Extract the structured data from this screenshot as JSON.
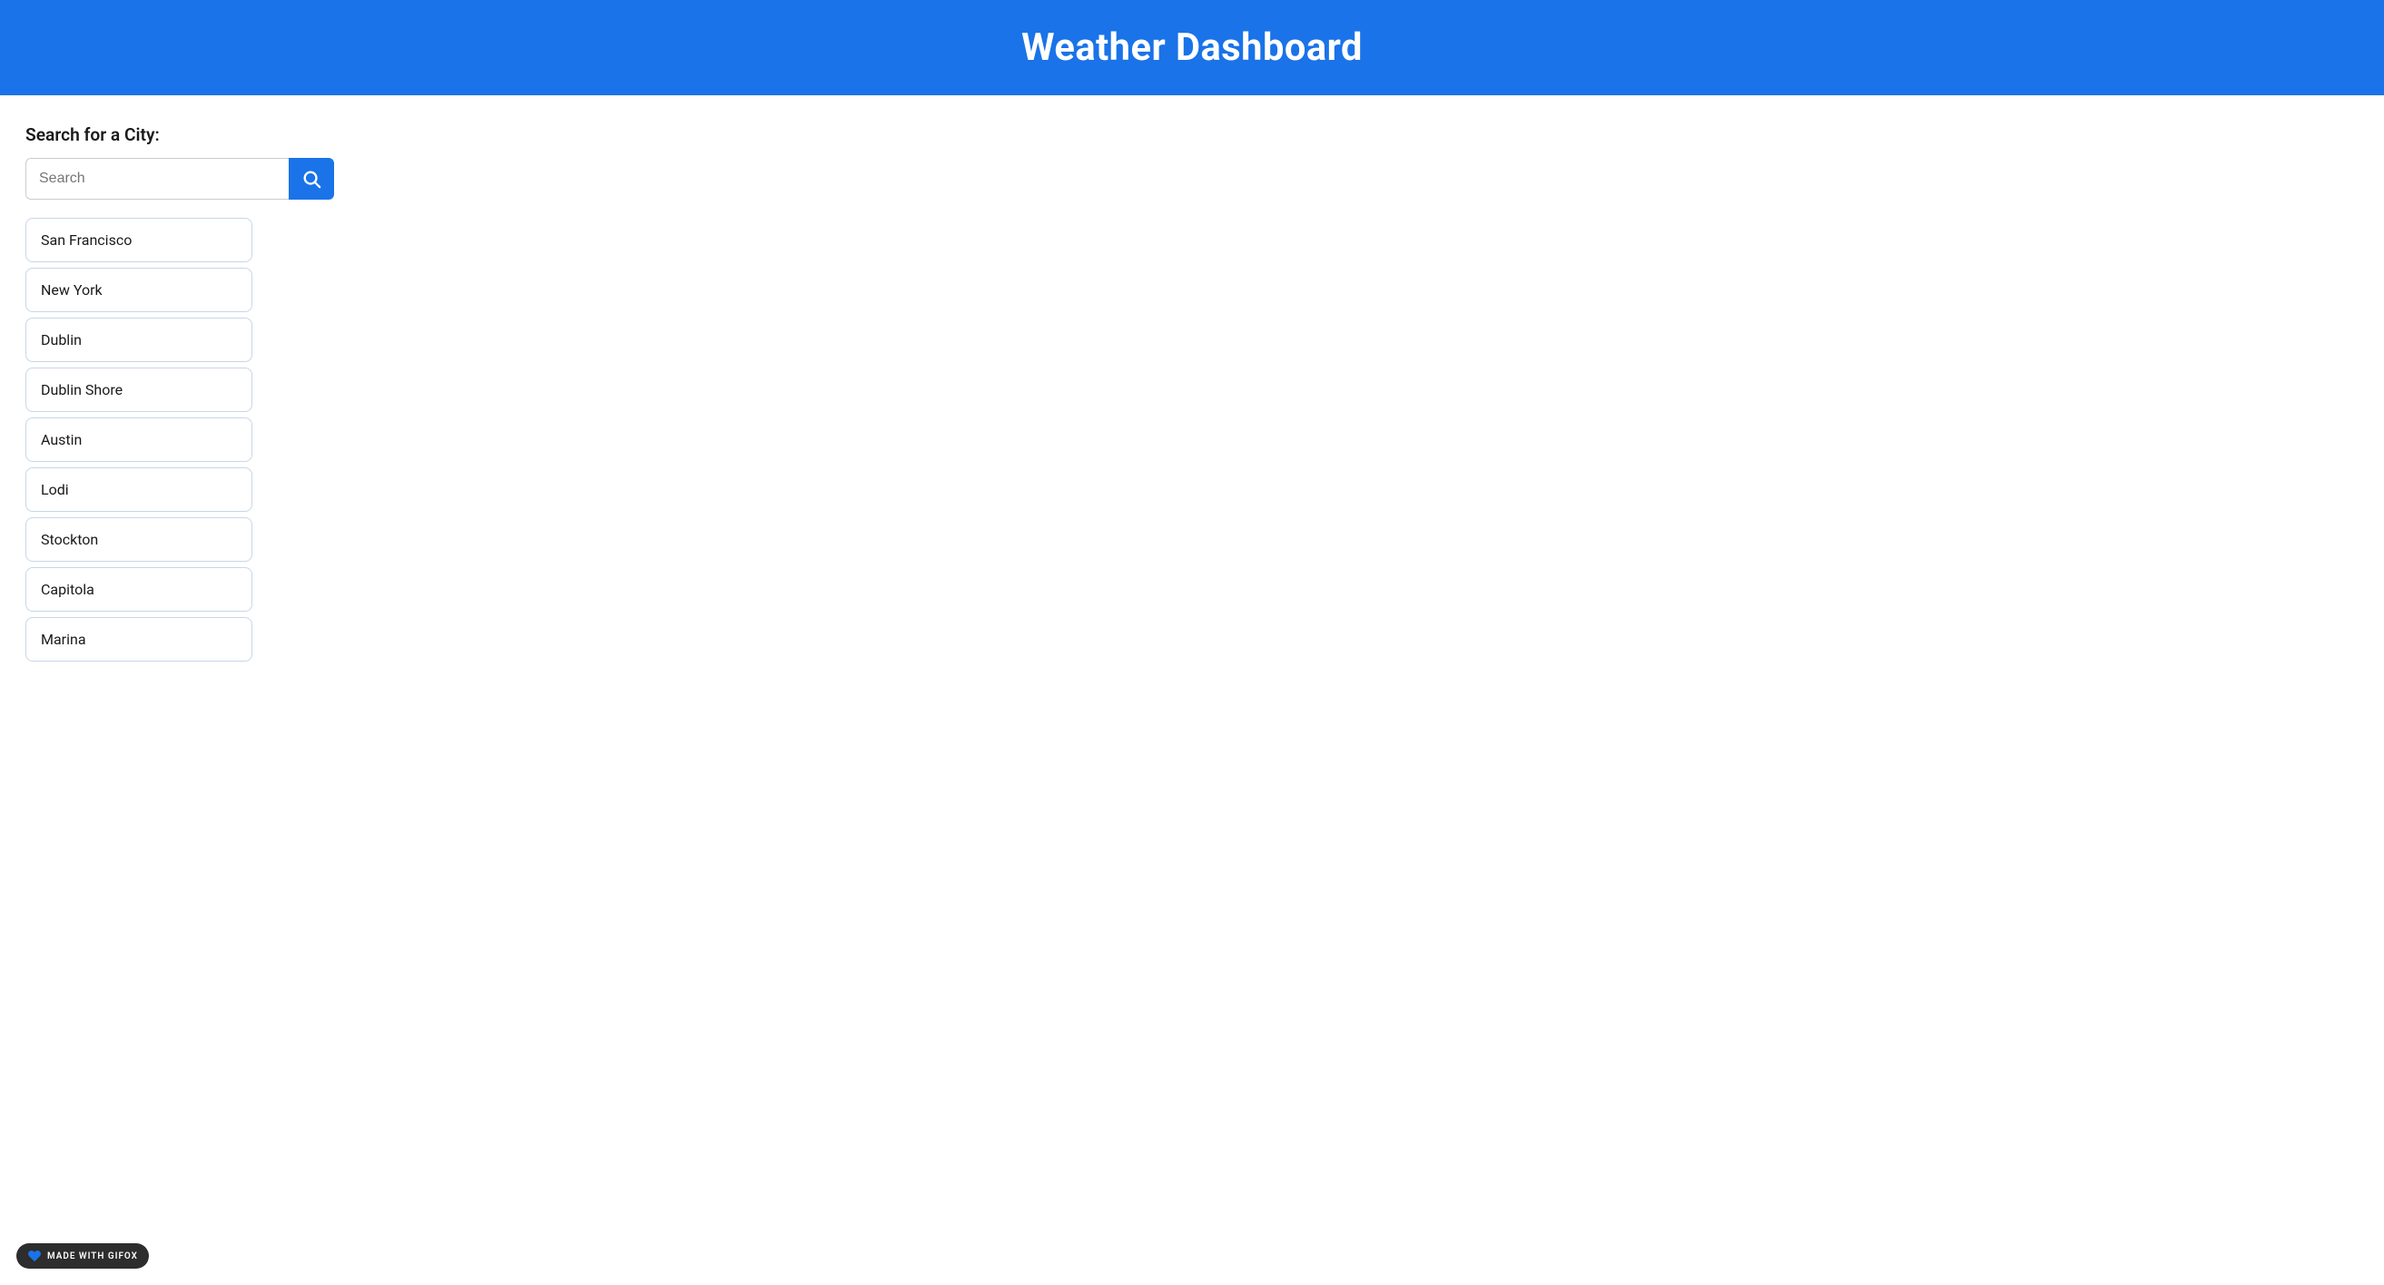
{
  "header": {
    "title": "Weather Dashboard"
  },
  "search": {
    "label": "Search for a City:",
    "placeholder": "Search",
    "button_label": "Search"
  },
  "cities": [
    {
      "name": "San Francisco"
    },
    {
      "name": "New York"
    },
    {
      "name": "Dublin"
    },
    {
      "name": "Dublin Shore"
    },
    {
      "name": "Austin"
    },
    {
      "name": "Lodi"
    },
    {
      "name": "Stockton"
    },
    {
      "name": "Capitola"
    },
    {
      "name": "Marina"
    }
  ],
  "badge": {
    "text": "MADE WITH GIFOX"
  }
}
